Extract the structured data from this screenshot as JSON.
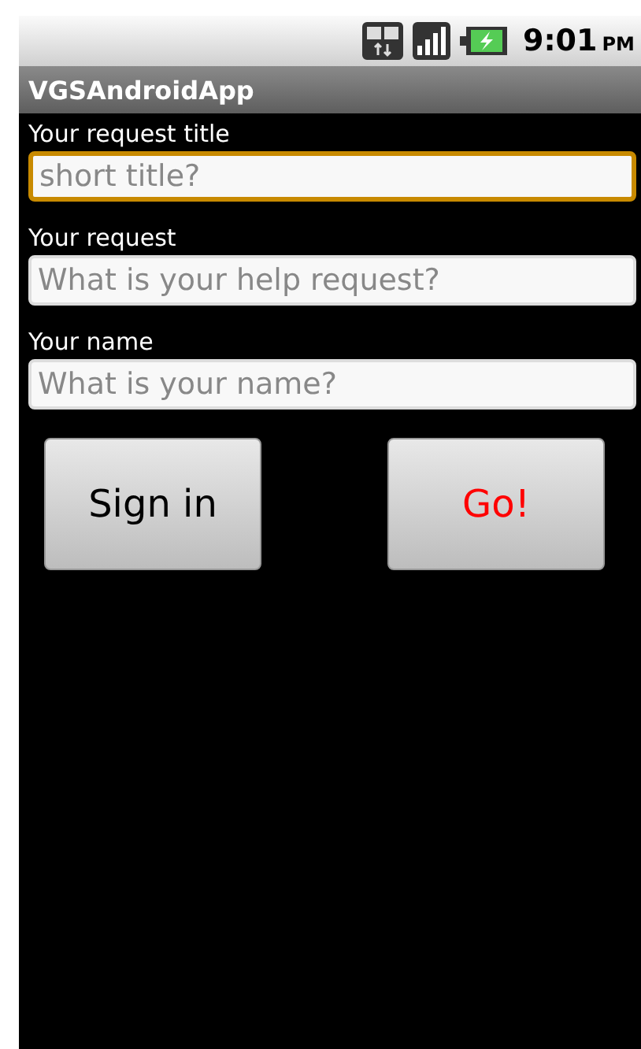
{
  "status_bar": {
    "time": "9:01",
    "time_suffix": "PM"
  },
  "title_bar": {
    "title": "VGSAndroidApp"
  },
  "fields": [
    {
      "label": "Your request title",
      "placeholder": "short title?",
      "focused": true
    },
    {
      "label": "Your request",
      "placeholder": "What is your help request?",
      "focused": false
    },
    {
      "label": "Your name",
      "placeholder": "What is your name?",
      "focused": false
    }
  ],
  "buttons": [
    {
      "label": "Sign in",
      "color": "#000000"
    },
    {
      "label": "Go!",
      "color": "#ff0000"
    }
  ]
}
